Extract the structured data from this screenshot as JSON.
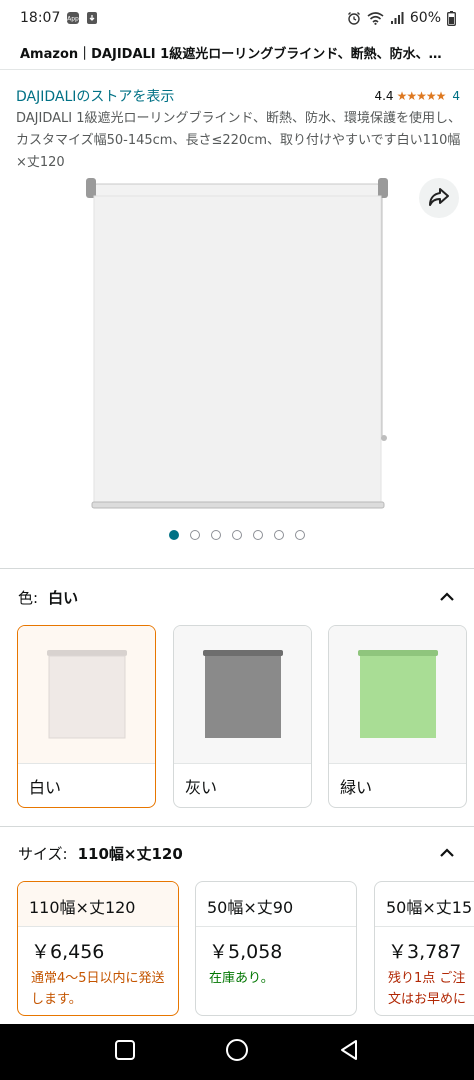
{
  "status_bar": {
    "time": "18:07",
    "battery": "60%",
    "icons": [
      "app-notification-icon",
      "download-notification-icon",
      "alarm-icon",
      "wifi-icon",
      "signal-icon",
      "battery-icon"
    ]
  },
  "header": {
    "title": "Amazon｜DAJIDALI 1級遮光ローリングブラインド、断熱、防水、…"
  },
  "product": {
    "store_link": "DAJIDALIのストアを表示",
    "rating_value": "4.4",
    "stars": "★★★★★",
    "rating_count": "4",
    "title": "DAJIDALI 1級遮光ローリングブラインド、断熱、防水、環境保護を使用し、カスタマイズ幅50-145cm、長さ≤220cm、取り付けやすいです白い110幅×丈120",
    "image_count": 7,
    "active_image": 0
  },
  "color_variation": {
    "label": "色:",
    "selected": "白い",
    "options": [
      {
        "name": "白い",
        "swatch_color": "#efe9e6"
      },
      {
        "name": "灰い",
        "swatch_color": "#8a8a8a"
      },
      {
        "name": "緑い",
        "swatch_color": "#a9dd95"
      }
    ]
  },
  "size_variation": {
    "label": "サイズ:",
    "selected": "110幅×丈120",
    "options": [
      {
        "name": "110幅×丈120",
        "price": "￥6,456",
        "note": "通常4～5日以内に発送します。"
      },
      {
        "name": "50幅×丈90",
        "price": "￥5,058",
        "note": "在庫あり。"
      },
      {
        "name": "50幅×丈15",
        "price": "￥3,787",
        "note": "残り1点 ご注文はお早めに"
      }
    ]
  },
  "colors": {
    "link": "#007185",
    "selected_border": "#e77600",
    "star": "#de7921"
  }
}
